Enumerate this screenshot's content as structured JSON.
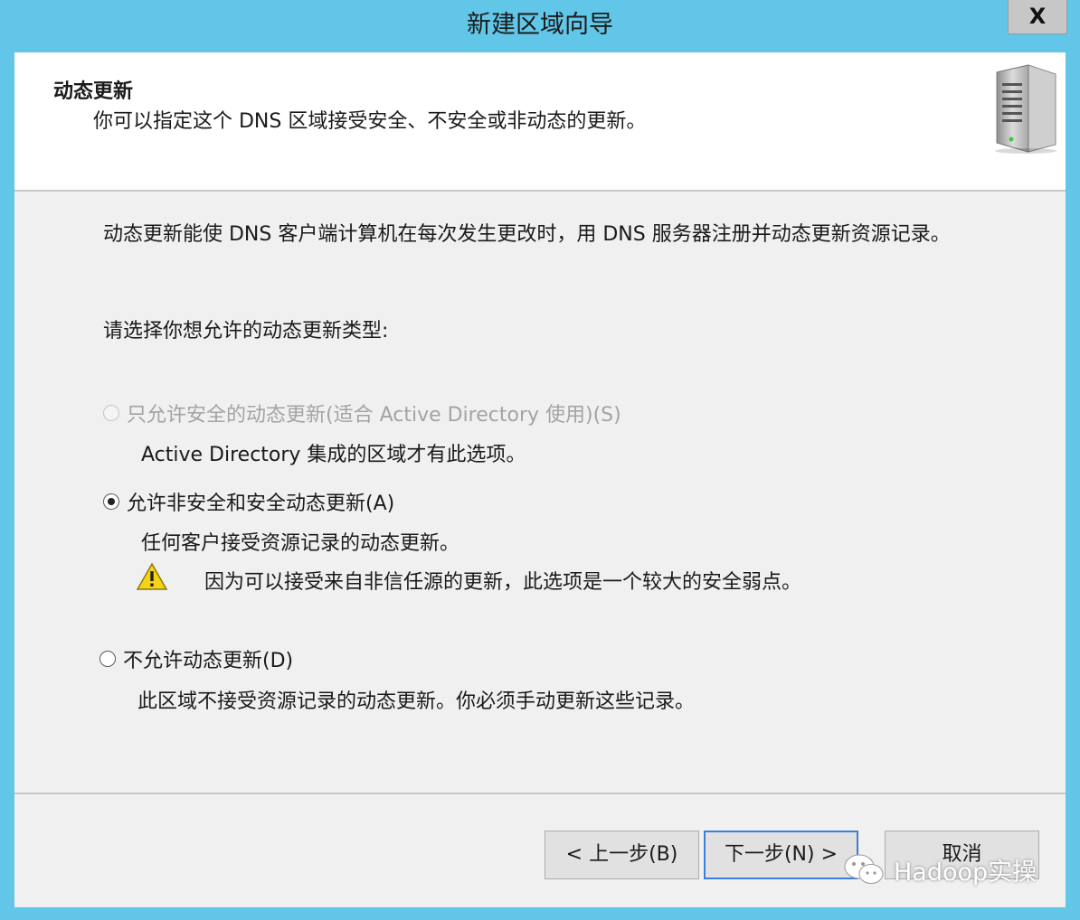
{
  "window": {
    "title": "新建区域向导",
    "close_label": "X"
  },
  "header": {
    "title": "动态更新",
    "subtitle": "你可以指定这个 DNS 区域接受安全、不安全或非动态的更新。",
    "icon": "server-icon"
  },
  "body": {
    "intro": "动态更新能使 DNS 客户端计算机在每次发生更改时，用 DNS 服务器注册并动态更新资源记录。",
    "prompt": "请选择你想允许的动态更新类型:",
    "options": [
      {
        "label": "只允许安全的动态更新(适合 Active Directory 使用)(S)",
        "description": "Active Directory 集成的区域才有此选项。",
        "enabled": false,
        "selected": false
      },
      {
        "label": "允许非安全和安全动态更新(A)",
        "description": "任何客户接受资源记录的动态更新。",
        "enabled": true,
        "selected": true
      },
      {
        "label": "不允许动态更新(D)",
        "description": "此区域不接受资源记录的动态更新。你必须手动更新这些记录。",
        "enabled": true,
        "selected": false
      }
    ],
    "warning": {
      "icon": "warning-icon",
      "text": "因为可以接受来自非信任源的更新，此选项是一个较大的安全弱点。"
    }
  },
  "footer": {
    "back_label": "< 上一步(B)",
    "next_label": "下一步(N) >",
    "cancel_label": "取消"
  },
  "watermark": {
    "text": "Hadoop实操",
    "icon": "wechat-icon"
  },
  "colors": {
    "titlebar": "#61c6e8",
    "dialog_bg": "#f0f0f0",
    "header_bg": "#ffffff",
    "default_button_border": "#3c7fd8"
  }
}
